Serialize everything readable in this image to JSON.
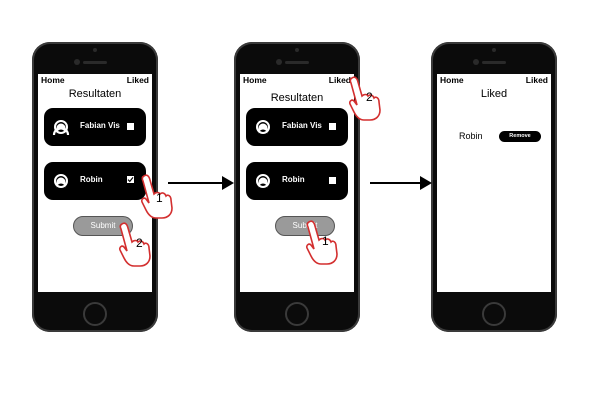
{
  "phones": [
    {
      "nav_left": "Home",
      "nav_right": "Liked",
      "title": "Resultaten",
      "cards": [
        {
          "name": "Fabian Vis"
        },
        {
          "name": "Robin"
        }
      ],
      "submit_label": "Submit"
    },
    {
      "nav_left": "Home",
      "nav_right": "Liked",
      "title": "Resultaten",
      "cards": [
        {
          "name": "Fabian Vis"
        },
        {
          "name": "Robin"
        }
      ],
      "submit_label": "Submit"
    },
    {
      "nav_left": "Home",
      "nav_right": "Liked",
      "title": "Liked",
      "liked_name": "Robin",
      "remove_label": "Remove"
    }
  ],
  "steps": {
    "p1_check": "1",
    "p1_submit": "2",
    "p2_submit": "1",
    "p2_liked": "2"
  },
  "colors": {
    "device": "#0b0b0b",
    "card": "#000000",
    "submit": "#9a9a9a",
    "hand_outline": "#d32f2f"
  }
}
